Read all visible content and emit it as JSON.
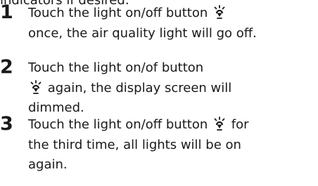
{
  "header_fragment": "indicators if desired:",
  "steps": [
    {
      "number": "1",
      "before_icon": "Touch the light on/off button",
      "icon": "light-button-icon",
      "after_icon": "once, the air quality light will go off."
    },
    {
      "number": "2",
      "line1": "Touch the light on/of  button",
      "icon": "light-button-icon",
      "after_icon": "again, the display screen will",
      "line3": "dimmed."
    },
    {
      "number": "3",
      "before_icon": "Touch the light on/off button",
      "icon": "light-button-icon",
      "after_icon": "for",
      "line2": "the third time, all lights will be on",
      "line3": "again."
    }
  ]
}
